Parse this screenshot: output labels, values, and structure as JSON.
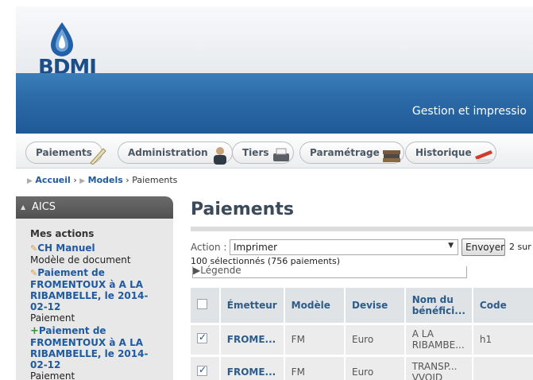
{
  "header": {
    "logo_text": "BDMI",
    "subtitle": "Gestion et impressio"
  },
  "nav": {
    "tabs": [
      {
        "label": "Paiements",
        "icon": "pen-icon"
      },
      {
        "label": "Administration",
        "icon": "user-icon"
      },
      {
        "label": "Tiers",
        "icon": "printer-icon"
      },
      {
        "label": "Paramétrage",
        "icon": "books-icon"
      },
      {
        "label": "Historique",
        "icon": "stapler-icon"
      }
    ]
  },
  "breadcrumb": {
    "home": "Accueil",
    "models": "Models",
    "current": "Paiements"
  },
  "sidebar": {
    "header": "AICS",
    "section_title": "Mes actions",
    "items": [
      {
        "link": "CH Manuel",
        "sub": "Modèle de document",
        "icon": "pencil"
      },
      {
        "link": "Paiement de FROMENTOUX à A LA RIBAMBELLE, le 2014-02-12",
        "sub": "Paiement",
        "icon": "pencil"
      },
      {
        "link": "Paiement de FROMENTOUX à A LA RIBAMBELLE, le 2014-02-12",
        "sub": "Paiement",
        "icon": "plus"
      }
    ]
  },
  "main": {
    "title": "Paiements",
    "action_label": "Action :",
    "action_value": "Imprimer",
    "send_label": "Envoyer",
    "count_right": "2 sur",
    "selected_text": "100 sélectionnés (756 paiements)",
    "legend": "▶Légende",
    "columns": [
      "Émetteur",
      "Modèle",
      "Devise",
      "Nom du bénéfici...",
      "Code"
    ],
    "rows": [
      {
        "checked": true,
        "emetteur": "FROME...",
        "modele": "FM",
        "devise": "Euro",
        "nom": "A LA RIBAMBE...",
        "code": "h1"
      },
      {
        "checked": true,
        "emetteur": "FROME...",
        "modele": "FM",
        "devise": "Euro",
        "nom": "TRANSP... VVOID",
        "code": ""
      }
    ]
  }
}
